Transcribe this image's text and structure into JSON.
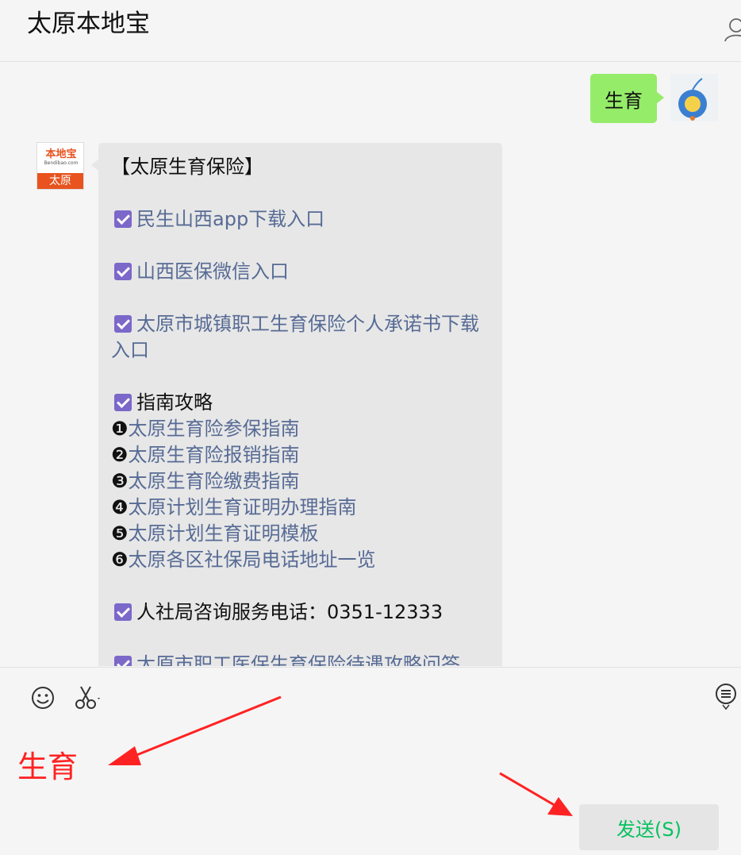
{
  "header": {
    "title": "太原本地宝",
    "user_icon": "user-icon"
  },
  "my_message": {
    "text": "生育"
  },
  "bot": {
    "avatar": {
      "logo_text": "本地宝",
      "logo_sub": "Bendibao.com",
      "city": "太原"
    },
    "message": {
      "title": "【太原生育保险】",
      "items": [
        "民生山西app下载入口",
        "山西医保微信入口",
        "太原市城镇职工生育保险个人承诺书下载入口",
        "指南攻略"
      ],
      "guides": [
        {
          "num": "❶",
          "text": "太原生育险参保指南"
        },
        {
          "num": "❷",
          "text": "太原生育险报销指南"
        },
        {
          "num": "❸",
          "text": "太原生育险缴费指南"
        },
        {
          "num": "❹",
          "text": "太原计划生育证明办理指南"
        },
        {
          "num": "❺",
          "text": "太原计划生育证明模板"
        },
        {
          "num": "❻",
          "text": "太原各区社保局电话地址一览"
        }
      ],
      "hotline": "人社局咨询服务电话：0351-12333",
      "cut_line": "太原市职工医保生育保险待遇攻略问答"
    }
  },
  "input": {
    "text": "生育",
    "send_label": "发送(S)"
  },
  "colors": {
    "bubble_self": "#95ec69",
    "bubble_other": "#e7e7e7",
    "link": "#576b95",
    "check": "#7b68c9",
    "send": "#07c160",
    "annotation": "#ff2222"
  }
}
